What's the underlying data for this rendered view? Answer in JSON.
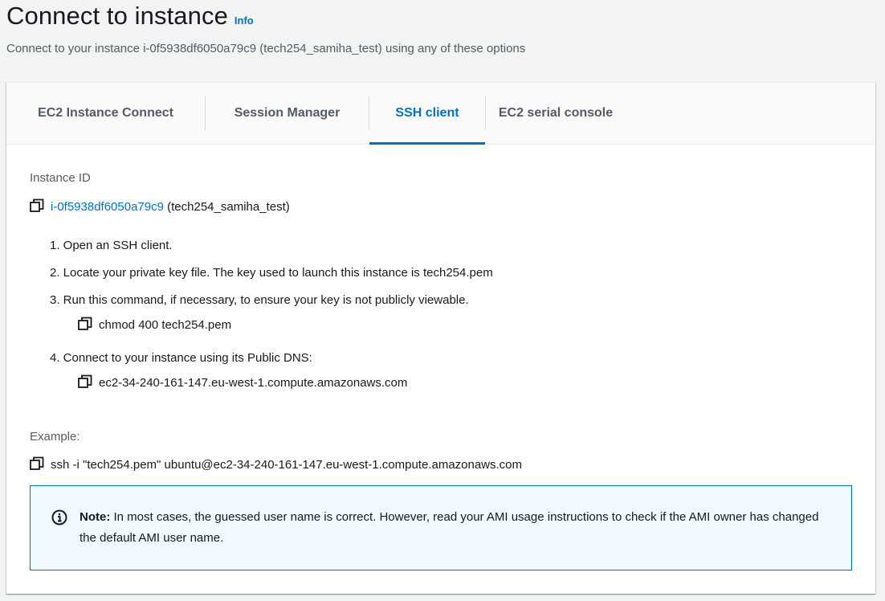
{
  "header": {
    "title": "Connect to instance",
    "info_label": "Info",
    "subtitle": "Connect to your instance i-0f5938df6050a79c9 (tech254_samiha_test) using any of these options"
  },
  "tabs": [
    {
      "label": "EC2 Instance Connect",
      "active": false
    },
    {
      "label": "Session Manager",
      "active": false
    },
    {
      "label": "SSH client",
      "active": true
    },
    {
      "label": "EC2 serial console",
      "active": false
    }
  ],
  "instance": {
    "label": "Instance ID",
    "id": "i-0f5938df6050a79c9",
    "name": "(tech254_samiha_test)"
  },
  "steps": [
    {
      "text": "1. Open an SSH client."
    },
    {
      "text": "2. Locate your private key file. The key used to launch this instance is tech254.pem"
    },
    {
      "text": "3. Run this command, if necessary, to ensure your key is not publicly viewable.",
      "command": "chmod 400 tech254.pem"
    },
    {
      "text": "4. Connect to your instance using its Public DNS:",
      "command": "ec2-34-240-161-147.eu-west-1.compute.amazonaws.com"
    }
  ],
  "example": {
    "label": "Example:",
    "command": "ssh -i \"tech254.pem\" ubuntu@ec2-34-240-161-147.eu-west-1.compute.amazonaws.com"
  },
  "note": {
    "heading": "Note:",
    "text": " In most cases, the guessed user name is correct. However, read your AMI usage instructions to check if the AMI owner has changed the default AMI user name.",
    "icon": "info-circle-icon"
  },
  "colors": {
    "accent": "#0073bb",
    "note_background": "#f1faff",
    "page_background": "#f2f3f3"
  }
}
